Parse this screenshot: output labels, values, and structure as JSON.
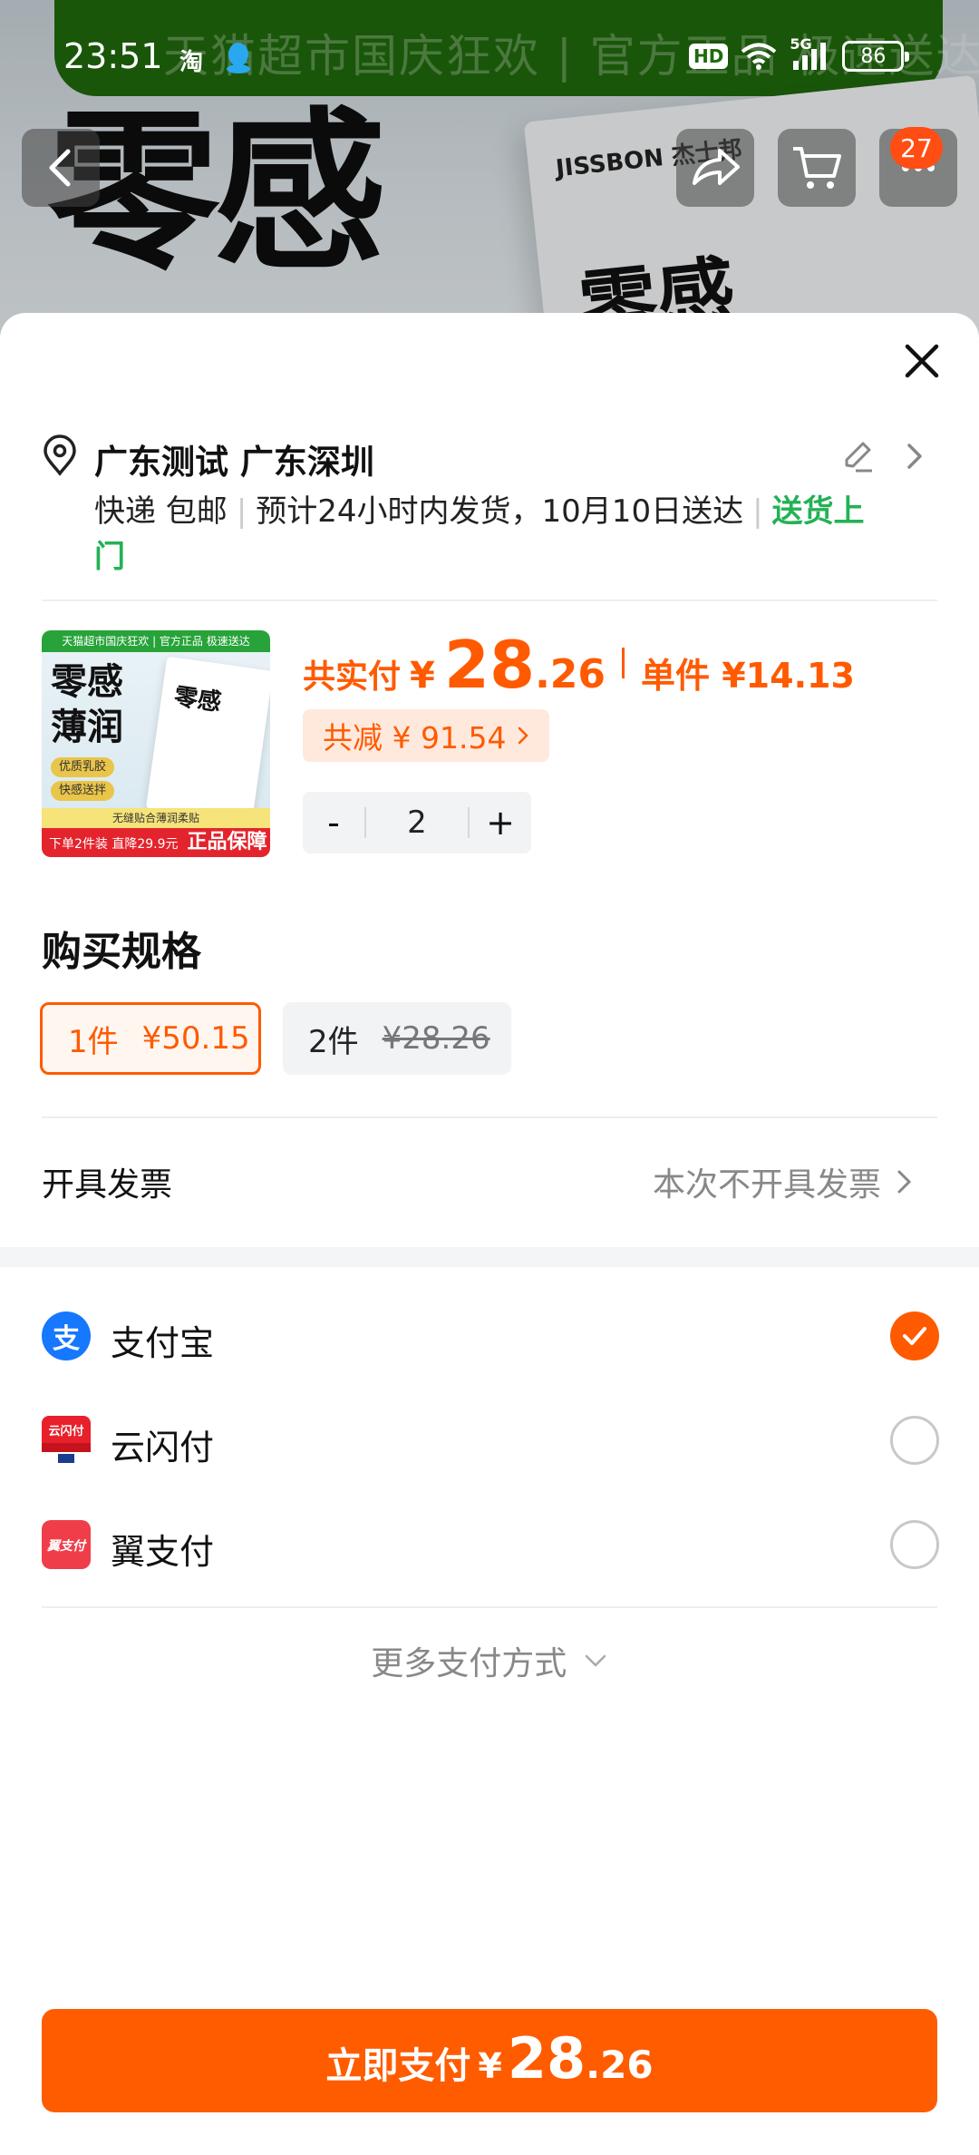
{
  "status_bar": {
    "time": "23:51",
    "app_icon_1": "淘",
    "app_icon_2": "qq-penguin-icon",
    "hd": "HD",
    "network": "5G",
    "battery": "86"
  },
  "background": {
    "banner_text": "天猫超市国庆狂欢 | 官方正品 极速送达",
    "big_title": "零感",
    "box_brand": "JISSBON 杰士邦",
    "box_title": "零感",
    "cart_badge": "27"
  },
  "address": {
    "name": "广东测试 广东深圳"
  },
  "shipping": {
    "method": "快递 包邮",
    "estimate": "预计24小时内发货，10月10日送达",
    "door": "送货上门"
  },
  "product_image": {
    "strip": "天猫超市国庆狂欢 | 官方正品 极速送达",
    "headline": "零感\n薄润",
    "pill1": "优质乳胶",
    "pill2": "快感送拌",
    "box_title": "零感",
    "bottom1": "无缝贴合薄润柔贴",
    "bottom2_small": "下单2件装 直降29.9元",
    "bottom2_big": "正品保障"
  },
  "price": {
    "label": "共实付",
    "currency": "¥",
    "integer": "28",
    "decimal": ".26",
    "unit_label": "单件 ¥14.13"
  },
  "savings": {
    "text": "共减 ¥ 91.54"
  },
  "quantity": {
    "minus": "-",
    "value": "2",
    "plus": "+"
  },
  "spec": {
    "title": "购买规格",
    "options": [
      {
        "qty": "1件",
        "price": "¥50.15",
        "selected": true
      },
      {
        "qty": "2件",
        "price": "¥28.26",
        "selected": false
      }
    ]
  },
  "invoice": {
    "label": "开具发票",
    "value": "本次不开具发票"
  },
  "payment": {
    "methods": [
      {
        "name": "支付宝",
        "icon": "alipay-icon",
        "selected": true
      },
      {
        "name": "云闪付",
        "icon": "unionpay-icon",
        "selected": false
      },
      {
        "name": "翼支付",
        "icon": "bestpay-icon",
        "selected": false
      }
    ],
    "more": "更多支付方式"
  },
  "pay_button": {
    "label": "立即支付",
    "currency": "¥",
    "integer": "28",
    "decimal": ".26"
  },
  "colors": {
    "accent": "#ff5a00",
    "green": "#23b255",
    "alipay": "#1677ff"
  }
}
